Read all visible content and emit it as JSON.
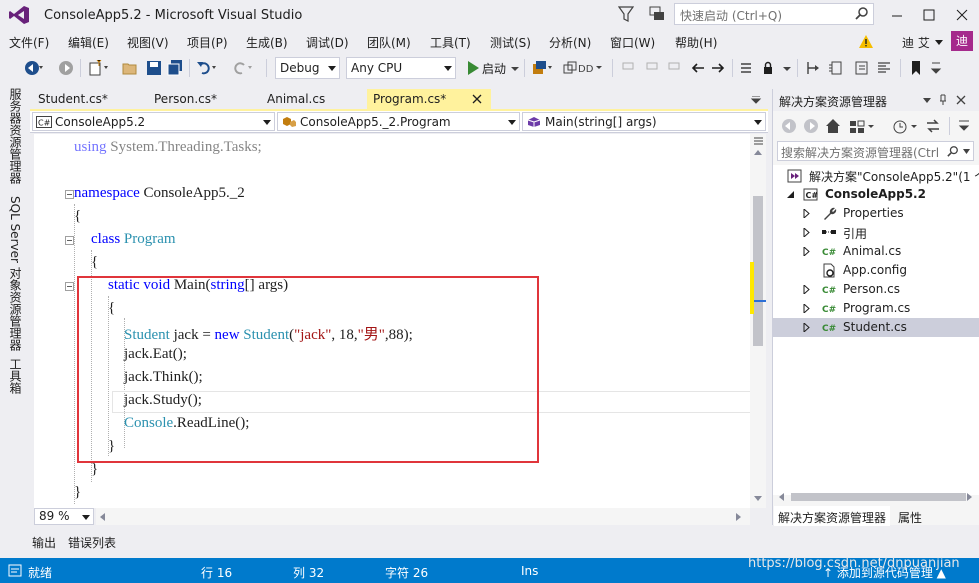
{
  "window": {
    "title": "ConsoleApp5.2 - Microsoft Visual Studio",
    "quick_launch_placeholder": "快速启动 (Ctrl+Q)"
  },
  "menu": [
    "文件(F)",
    "编辑(E)",
    "视图(V)",
    "项目(P)",
    "生成(B)",
    "调试(D)",
    "团队(M)",
    "工具(T)",
    "测试(S)",
    "分析(N)",
    "窗口(W)",
    "帮助(H)"
  ],
  "user": {
    "name": "迪 艾",
    "avatar_initial": "迪"
  },
  "toolbar": {
    "config": "Debug",
    "platform": "Any CPU",
    "run_label": "启动"
  },
  "left_tool_tabs": [
    "服务器资源管理器",
    "SQL Server 对象资源管理器",
    "工具箱"
  ],
  "editor_tabs": [
    {
      "label": "Student.cs*"
    },
    {
      "label": "Person.cs*"
    },
    {
      "label": "Animal.cs"
    },
    {
      "label": "Program.cs*"
    }
  ],
  "navbar": {
    "project": "ConsoleApp5.2",
    "class": "ConsoleApp5._2.Program",
    "member": "Main(string[] args)",
    "cs_badge": "C#"
  },
  "code": {
    "l1": {
      "kw": "using",
      "rest": " System.Threading.Tasks;"
    },
    "l2": {
      "kw": "namespace",
      "rest": " ConsoleApp5._2"
    },
    "l3": "{",
    "l4": {
      "kw": "class",
      "ty": " Program"
    },
    "l5": "{",
    "l6": {
      "kw": "static void",
      "name": " Main(",
      "ty": "string",
      "rest": "[] args)"
    },
    "l7": "{",
    "l8": {
      "ty1": "Student",
      "mid1": " jack = ",
      "kw": "new",
      "ty2": " Student",
      "mid2": "(",
      "str1": "\"jack\"",
      "mid3": ", 18,",
      "str2": "\"男\"",
      "mid4": ",88);"
    },
    "l9": "jack.Eat();",
    "l10": "jack.Think();",
    "l11": "jack.Study();",
    "l12": {
      "ty": "Console",
      "rest": ".ReadLine();"
    },
    "l13": "}",
    "l14": "}",
    "l15": "}"
  },
  "zoom": "89 %",
  "bottom_tabs": [
    "输出",
    "错误列表"
  ],
  "solution_explorer": {
    "title": "解决方案资源管理器",
    "search_placeholder": "搜索解决方案资源管理器(Ctrl",
    "tree": [
      {
        "label": "解决方案\"ConsoleApp5.2\"(1 个",
        "icon": "solution-icon"
      },
      {
        "label": "ConsoleApp5.2",
        "icon": "csharp-project-icon"
      },
      {
        "label": "Properties",
        "icon": "wrench-icon"
      },
      {
        "label": "引用",
        "icon": "references-icon"
      },
      {
        "label": "Animal.cs",
        "icon": "csharp-file-icon"
      },
      {
        "label": "App.config",
        "icon": "config-file-icon"
      },
      {
        "label": "Person.cs",
        "icon": "csharp-file-icon"
      },
      {
        "label": "Program.cs",
        "icon": "csharp-file-icon"
      },
      {
        "label": "Student.cs",
        "icon": "csharp-file-icon"
      }
    ],
    "cs_glyph": "C#",
    "bottom_tabs": [
      "解决方案资源管理器",
      "属性"
    ]
  },
  "status": {
    "state": "就绪",
    "row": "行 16",
    "col": "列 32",
    "char": "字符 26",
    "mode": "Ins",
    "source_control": "↑ 添加到源代码管理 ▲"
  },
  "watermark": "https://blog.csdn.net/dnpuanjian",
  "colors": {
    "accent": "#007ACC",
    "highlight_box": "#E0353B",
    "active_tab": "#FFF29D",
    "keyword": "#0000FF",
    "type": "#2B91AF",
    "string": "#A31515"
  }
}
